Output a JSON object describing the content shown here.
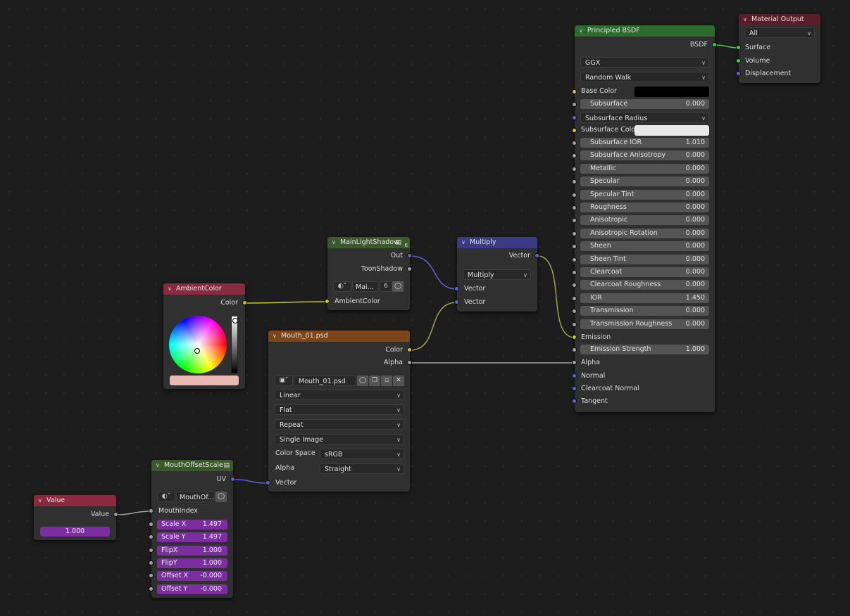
{
  "colors": {
    "header_shader": "#2c6a2d",
    "header_input": "#8a2a40",
    "header_group": "#3b5a2c",
    "header_texture": "#7b4419",
    "header_vector": "#3a3a86",
    "header_output": "#5a1d2c",
    "socket_color": "#c7c729",
    "socket_float": "#a1a1a1",
    "socket_vector": "#6363c7",
    "socket_shader": "#44c944",
    "ambient_swatch": "#e9bab3"
  },
  "ambient": {
    "title": "AmbientColor",
    "out_color": "Color"
  },
  "mls": {
    "title": "MainLightShadow",
    "badge": "6",
    "out": "Out",
    "toon": "ToonShadow",
    "group_name": "Mai...",
    "users": "6",
    "in_ambient": "AmbientColor"
  },
  "multiply": {
    "title": "Multiply",
    "out_vector": "Vector",
    "operation": "Multiply",
    "in_vector1": "Vector",
    "in_vector2": "Vector"
  },
  "mouth": {
    "title": "Mouth_01.psd",
    "out_color": "Color",
    "out_alpha": "Alpha",
    "image_name": "Mouth_01.psd",
    "interpolation": "Linear",
    "projection": "Flat",
    "extension": "Repeat",
    "source": "Single Image",
    "colorspace_label": "Color Space",
    "colorspace": "sRGB",
    "alpha_label": "Alpha",
    "alpha_mode": "Straight",
    "in_vector": "Vector"
  },
  "mos": {
    "title": "MouthOffsetScale",
    "out_uv": "UV",
    "group_name": "MouthOf...",
    "mouth_index": "MouthIndex",
    "params": [
      {
        "label": "Scale X",
        "value": "1.497"
      },
      {
        "label": "Scale Y",
        "value": "1.497"
      },
      {
        "label": "FlipX",
        "value": "1.000"
      },
      {
        "label": "FlipY",
        "value": "1.000"
      },
      {
        "label": "Offset X",
        "value": "-0.000"
      },
      {
        "label": "Offset Y",
        "value": "-0.000"
      }
    ]
  },
  "value_node": {
    "title": "Value",
    "out": "Value",
    "value": "1.000"
  },
  "bsdf": {
    "title": "Principled BSDF",
    "out": "BSDF",
    "distribution": "GGX",
    "subsurface_method": "Random Walk",
    "base_color": "Base Color",
    "subsurface": {
      "label": "Subsurface",
      "value": "0.000"
    },
    "subsurface_radius": "Subsurface Radius",
    "subsurface_color": "Subsurface Color",
    "fields": [
      {
        "label": "Subsurface IOR",
        "value": "1.010"
      },
      {
        "label": "Subsurface Anisotropy",
        "value": "0.000"
      },
      {
        "label": "Metallic",
        "value": "0.000"
      },
      {
        "label": "Specular",
        "value": "0.000"
      },
      {
        "label": "Specular Tint",
        "value": "0.000"
      },
      {
        "label": "Roughness",
        "value": "0.000"
      },
      {
        "label": "Anisotropic",
        "value": "0.000"
      },
      {
        "label": "Anisotropic Rotation",
        "value": "0.000"
      },
      {
        "label": "Sheen",
        "value": "0.000"
      },
      {
        "label": "Sheen Tint",
        "value": "0.000"
      },
      {
        "label": "Clearcoat",
        "value": "0.000"
      },
      {
        "label": "Clearcoat Roughness",
        "value": "0.000"
      },
      {
        "label": "IOR",
        "value": "1.450"
      },
      {
        "label": "Transmission",
        "value": "0.000"
      },
      {
        "label": "Transmission Roughness",
        "value": "0.000"
      }
    ],
    "emission": "Emission",
    "emission_strength": {
      "label": "Emission Strength",
      "value": "1.000"
    },
    "alpha": "Alpha",
    "normal": "Normal",
    "clearcoat_normal": "Clearcoat Normal",
    "tangent": "Tangent"
  },
  "output": {
    "title": "Material Output",
    "target": "All",
    "surface": "Surface",
    "volume": "Volume",
    "displacement": "Displacement"
  }
}
